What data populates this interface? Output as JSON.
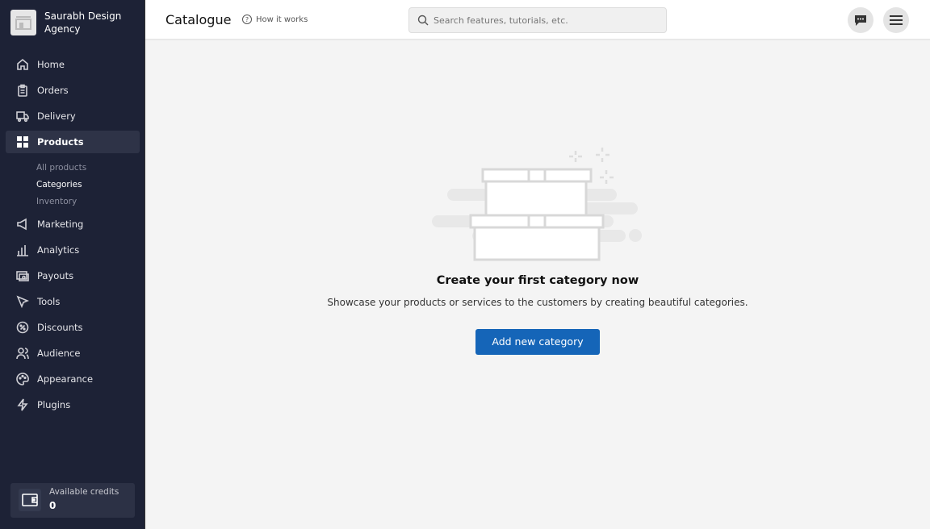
{
  "brand": {
    "name": "Saurabh Design Agency"
  },
  "sidebar": {
    "items": [
      {
        "label": "Home",
        "icon": "home-icon"
      },
      {
        "label": "Orders",
        "icon": "clipboard-icon"
      },
      {
        "label": "Delivery",
        "icon": "truck-icon"
      },
      {
        "label": "Products",
        "icon": "grid-icon"
      },
      {
        "label": "Marketing",
        "icon": "megaphone-icon"
      },
      {
        "label": "Analytics",
        "icon": "bar-chart-icon"
      },
      {
        "label": "Payouts",
        "icon": "payouts-icon"
      },
      {
        "label": "Tools",
        "icon": "pointer-icon"
      },
      {
        "label": "Discounts",
        "icon": "discount-icon"
      },
      {
        "label": "Audience",
        "icon": "users-icon"
      },
      {
        "label": "Appearance",
        "icon": "palette-icon"
      },
      {
        "label": "Plugins",
        "icon": "bolt-icon"
      }
    ],
    "subitems": [
      "All products",
      "Categories",
      "Inventory"
    ],
    "credits": {
      "label": "Available credits",
      "value": "0"
    }
  },
  "header": {
    "title": "Catalogue",
    "how": "How it works",
    "search_placeholder": "Search features, tutorials, etc."
  },
  "empty": {
    "title": "Create your first category now",
    "text": "Showcase your products or services to the customers by creating beautiful categories.",
    "button": "Add new category"
  }
}
